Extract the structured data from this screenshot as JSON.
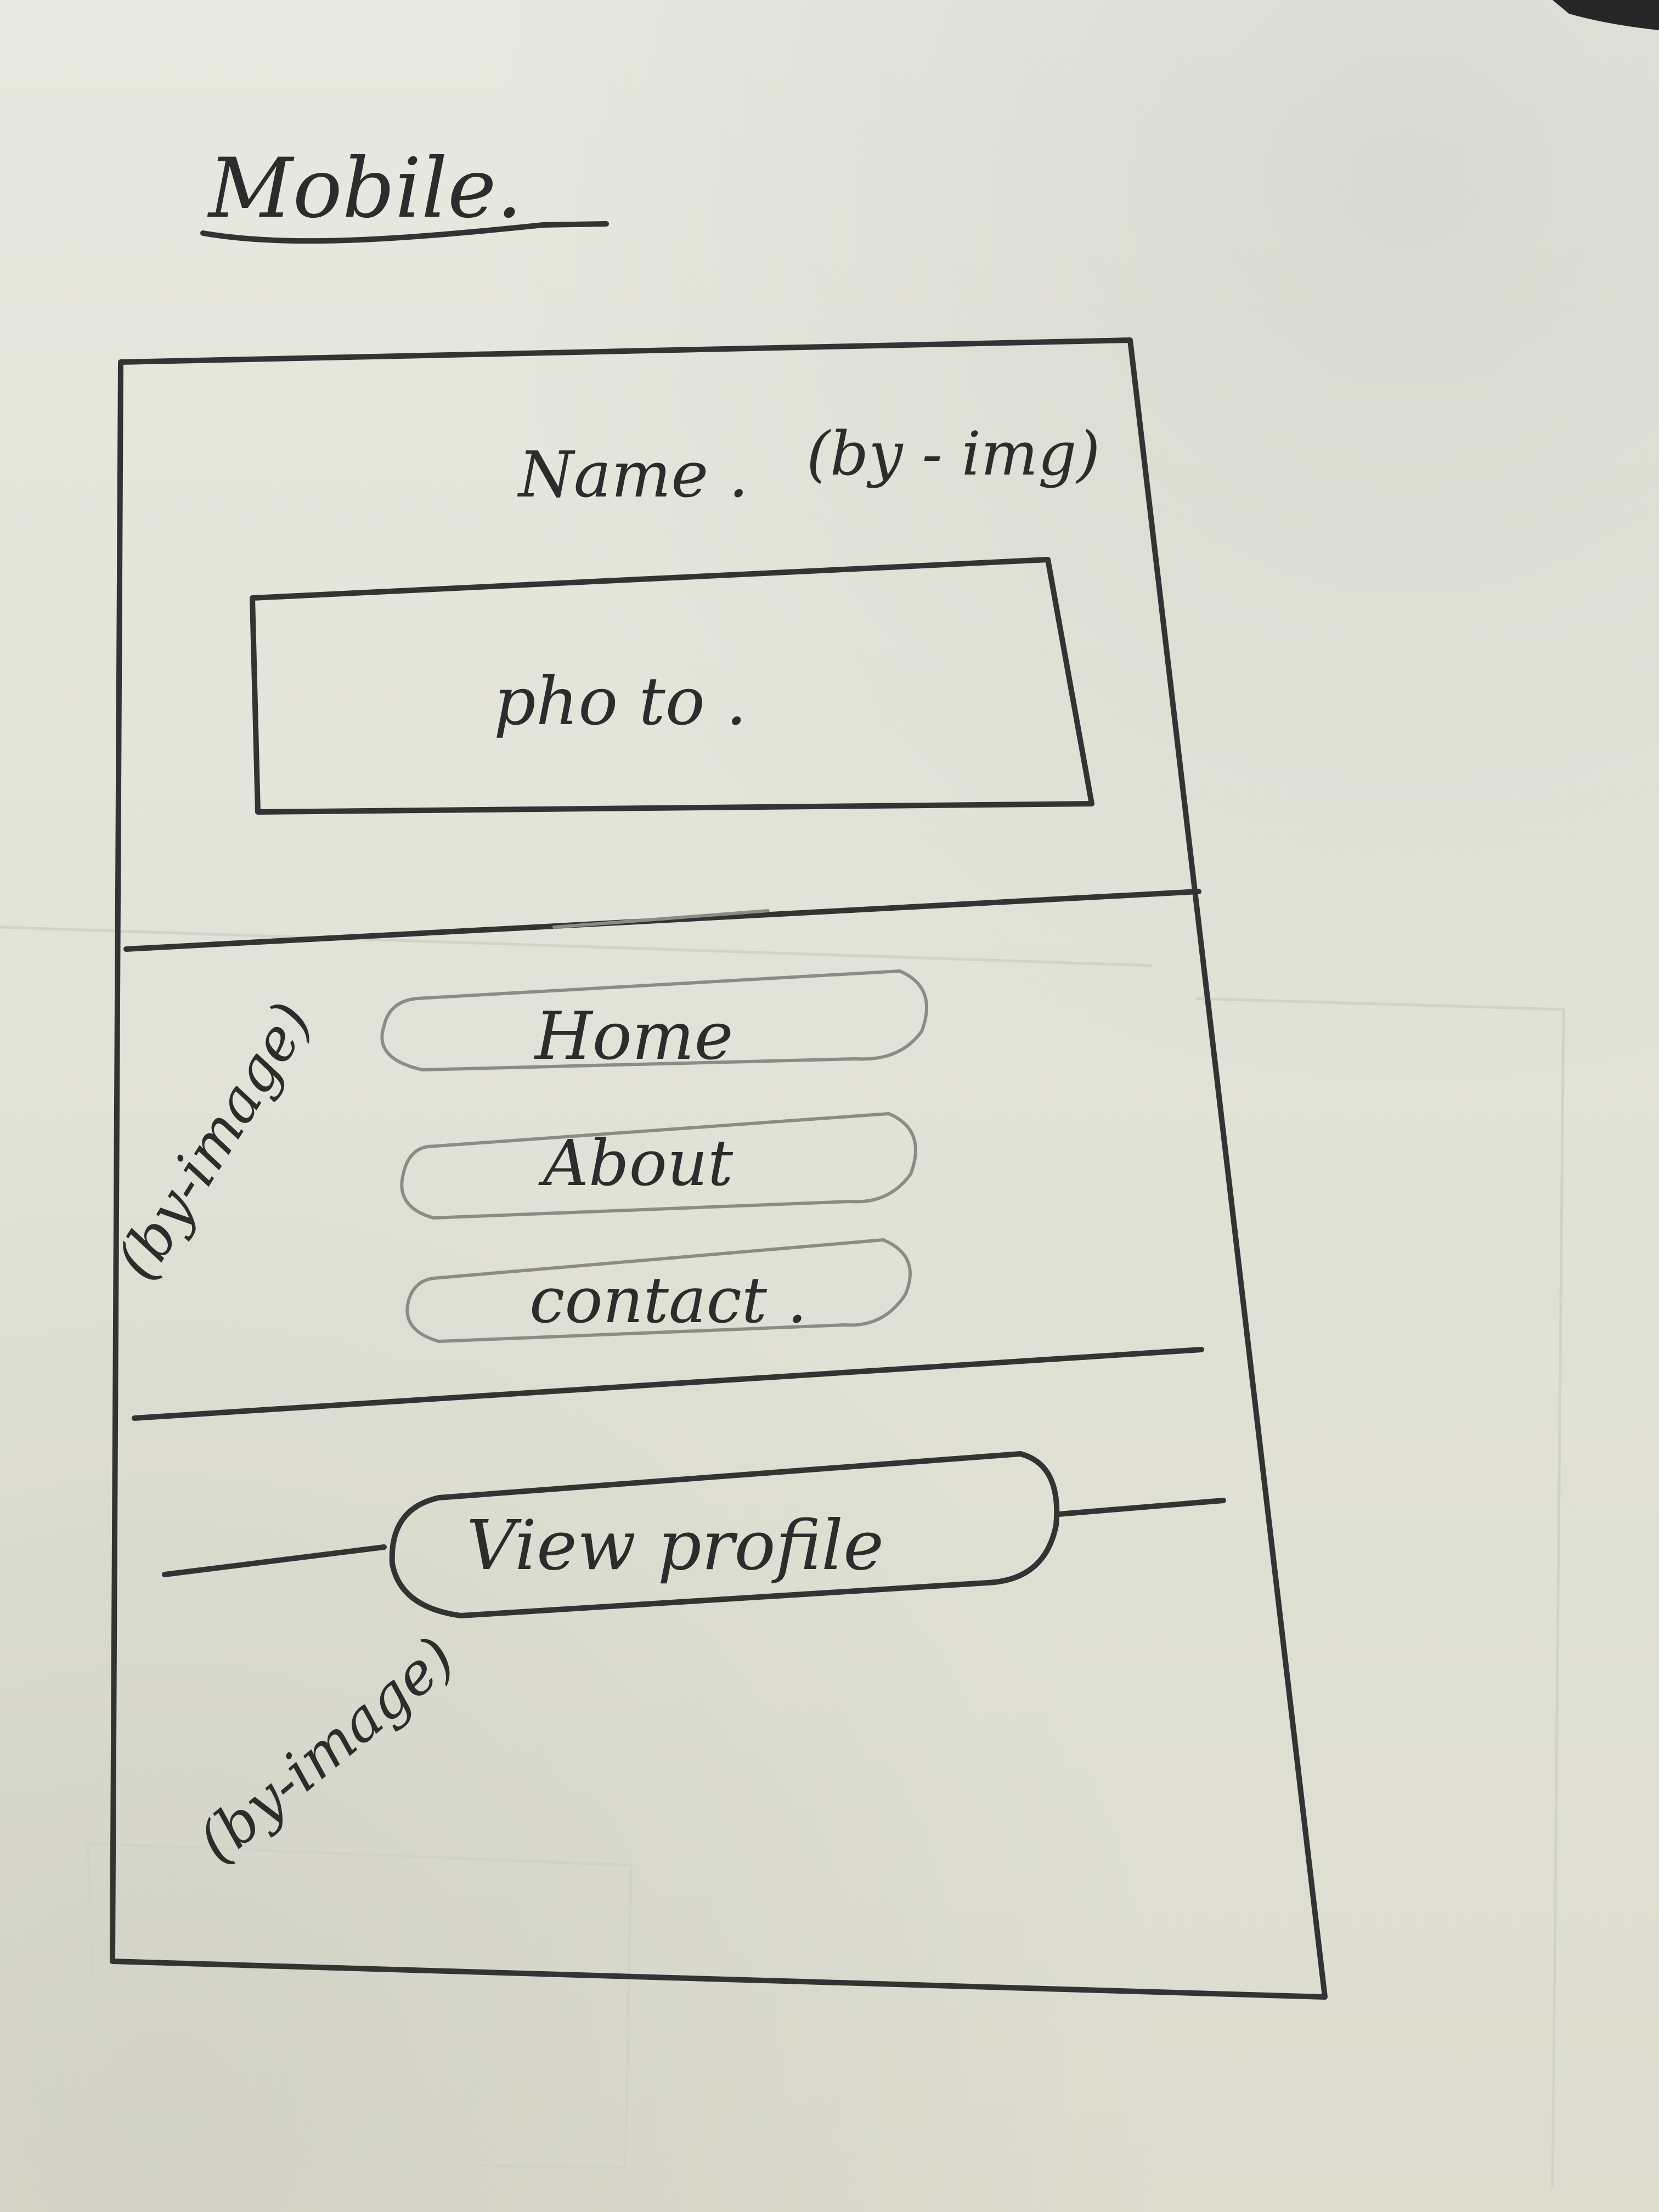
{
  "page": {
    "heading": "Mobile."
  },
  "wireframe": {
    "header": {
      "name_label": "Name .",
      "name_note": "(by - img)",
      "photo_label": "pho to ."
    },
    "nav": {
      "note": "(by-image)",
      "items": [
        {
          "label": "Home"
        },
        {
          "label": "About"
        },
        {
          "label": "contact ."
        }
      ]
    },
    "footer": {
      "button_label": "View profile",
      "note": "(by-image)"
    }
  },
  "colors": {
    "paper": "#e4e5da",
    "ink": "#333333",
    "pencil": "#8c8c84"
  }
}
